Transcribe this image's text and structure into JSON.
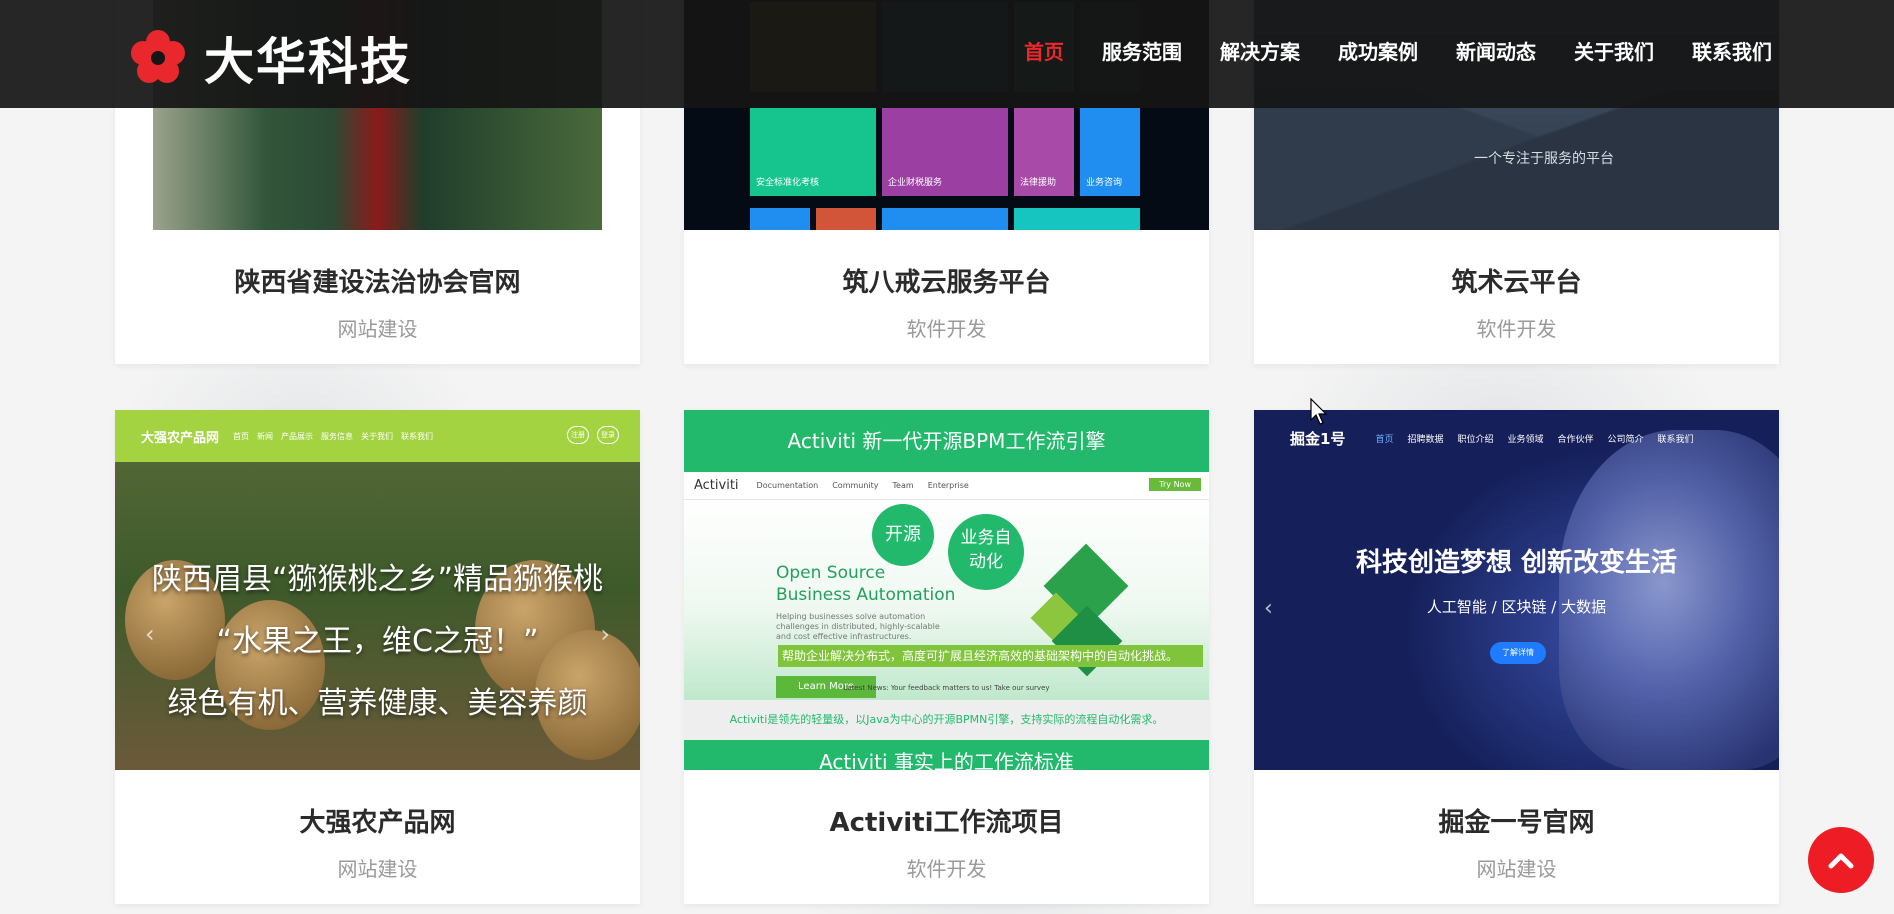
{
  "brand": {
    "name": "大华科技",
    "logo_icon": "red-flower-logo-icon",
    "accent_color": "#e8282c"
  },
  "nav": {
    "items": [
      {
        "label": "首页",
        "active": true
      },
      {
        "label": "服务范围",
        "active": false
      },
      {
        "label": "解决方案",
        "active": false
      },
      {
        "label": "成功案例",
        "active": false
      },
      {
        "label": "新闻动态",
        "active": false
      },
      {
        "label": "关于我们",
        "active": false
      },
      {
        "label": "联系我们",
        "active": false
      }
    ]
  },
  "cases": [
    {
      "title": "陕西省建设法治协会官网",
      "category": "网站建设"
    },
    {
      "title": "筑八戒云服务平台",
      "category": "软件开发"
    },
    {
      "title": "筑术云平台",
      "category": "软件开发"
    },
    {
      "title": "大强农产品网",
      "category": "网站建设"
    },
    {
      "title": "Activiti工作流项目",
      "category": "软件开发"
    },
    {
      "title": "掘金一号官网",
      "category": "网站建设"
    }
  ],
  "thumbs": {
    "zhubajie_tiles": [
      "安全标准化考核",
      "企业财税服务",
      "法律援助",
      "业务咨询"
    ],
    "zhushu": {
      "slogan": "一个专注于服务的平台"
    },
    "kiwi": {
      "site_name": "大强农产品网",
      "nav": "首页　新闻　产品展示　服务信息　关于我们　联系我们",
      "pill1": "注册",
      "pill2": "登录",
      "line1": "陕西眉县“猕猴桃之乡”精品猕猴桃",
      "line2": "“水果之王，维C之冠！”",
      "line3": "绿色有机、营养健康、美容养颜"
    },
    "activiti": {
      "banner_top": "Activiti  新一代开源BPM工作流引擎",
      "brand": "Activiti",
      "nav": [
        "Documentation",
        "Community",
        "Team",
        "Enterprise"
      ],
      "try": "Try Now",
      "bubble1": "开源",
      "bubble2": "业务自动化",
      "oss_line1": "Open Source",
      "oss_line2": "Business Automation",
      "small": "Helping businesses solve automation challenges in distributed, highly-scalable and cost effective infrastructures.",
      "learn": "Learn More",
      "green_banner": "帮助企业解决分布式，高度可扩展且经济高效的基础架构中的自动化挑战。",
      "news": "Latest News: Your feedback matters to us! Take our survey",
      "gray": "Activiti是领先的轻量级，以Java为中心的开源BPMN引擎，支持实际的流程自动化需求。",
      "bottom": "Activiti  事实上的工作流标准"
    },
    "robot": {
      "logo": "掘金1号",
      "nav": [
        "首页",
        "招聘数据",
        "职位介绍",
        "业务领域",
        "合作伙伴",
        "公司简介",
        "联系我们"
      ],
      "headline": "科技创造梦想 创新改变生活",
      "sub": "人工智能 / 区块链 / 大数据",
      "button": "了解详情"
    }
  },
  "scroll_top_icon": "chevron-up-icon"
}
